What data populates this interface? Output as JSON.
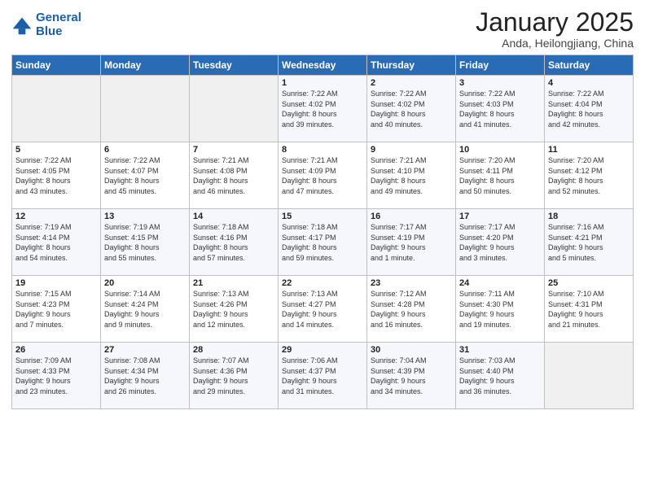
{
  "header": {
    "logo_line1": "General",
    "logo_line2": "Blue",
    "title": "January 2025",
    "subtitle": "Anda, Heilongjiang, China"
  },
  "weekdays": [
    "Sunday",
    "Monday",
    "Tuesday",
    "Wednesday",
    "Thursday",
    "Friday",
    "Saturday"
  ],
  "weeks": [
    [
      {
        "day": "",
        "info": ""
      },
      {
        "day": "",
        "info": ""
      },
      {
        "day": "",
        "info": ""
      },
      {
        "day": "1",
        "info": "Sunrise: 7:22 AM\nSunset: 4:02 PM\nDaylight: 8 hours\nand 39 minutes."
      },
      {
        "day": "2",
        "info": "Sunrise: 7:22 AM\nSunset: 4:02 PM\nDaylight: 8 hours\nand 40 minutes."
      },
      {
        "day": "3",
        "info": "Sunrise: 7:22 AM\nSunset: 4:03 PM\nDaylight: 8 hours\nand 41 minutes."
      },
      {
        "day": "4",
        "info": "Sunrise: 7:22 AM\nSunset: 4:04 PM\nDaylight: 8 hours\nand 42 minutes."
      }
    ],
    [
      {
        "day": "5",
        "info": "Sunrise: 7:22 AM\nSunset: 4:05 PM\nDaylight: 8 hours\nand 43 minutes."
      },
      {
        "day": "6",
        "info": "Sunrise: 7:22 AM\nSunset: 4:07 PM\nDaylight: 8 hours\nand 45 minutes."
      },
      {
        "day": "7",
        "info": "Sunrise: 7:21 AM\nSunset: 4:08 PM\nDaylight: 8 hours\nand 46 minutes."
      },
      {
        "day": "8",
        "info": "Sunrise: 7:21 AM\nSunset: 4:09 PM\nDaylight: 8 hours\nand 47 minutes."
      },
      {
        "day": "9",
        "info": "Sunrise: 7:21 AM\nSunset: 4:10 PM\nDaylight: 8 hours\nand 49 minutes."
      },
      {
        "day": "10",
        "info": "Sunrise: 7:20 AM\nSunset: 4:11 PM\nDaylight: 8 hours\nand 50 minutes."
      },
      {
        "day": "11",
        "info": "Sunrise: 7:20 AM\nSunset: 4:12 PM\nDaylight: 8 hours\nand 52 minutes."
      }
    ],
    [
      {
        "day": "12",
        "info": "Sunrise: 7:19 AM\nSunset: 4:14 PM\nDaylight: 8 hours\nand 54 minutes."
      },
      {
        "day": "13",
        "info": "Sunrise: 7:19 AM\nSunset: 4:15 PM\nDaylight: 8 hours\nand 55 minutes."
      },
      {
        "day": "14",
        "info": "Sunrise: 7:18 AM\nSunset: 4:16 PM\nDaylight: 8 hours\nand 57 minutes."
      },
      {
        "day": "15",
        "info": "Sunrise: 7:18 AM\nSunset: 4:17 PM\nDaylight: 8 hours\nand 59 minutes."
      },
      {
        "day": "16",
        "info": "Sunrise: 7:17 AM\nSunset: 4:19 PM\nDaylight: 9 hours\nand 1 minute."
      },
      {
        "day": "17",
        "info": "Sunrise: 7:17 AM\nSunset: 4:20 PM\nDaylight: 9 hours\nand 3 minutes."
      },
      {
        "day": "18",
        "info": "Sunrise: 7:16 AM\nSunset: 4:21 PM\nDaylight: 9 hours\nand 5 minutes."
      }
    ],
    [
      {
        "day": "19",
        "info": "Sunrise: 7:15 AM\nSunset: 4:23 PM\nDaylight: 9 hours\nand 7 minutes."
      },
      {
        "day": "20",
        "info": "Sunrise: 7:14 AM\nSunset: 4:24 PM\nDaylight: 9 hours\nand 9 minutes."
      },
      {
        "day": "21",
        "info": "Sunrise: 7:13 AM\nSunset: 4:26 PM\nDaylight: 9 hours\nand 12 minutes."
      },
      {
        "day": "22",
        "info": "Sunrise: 7:13 AM\nSunset: 4:27 PM\nDaylight: 9 hours\nand 14 minutes."
      },
      {
        "day": "23",
        "info": "Sunrise: 7:12 AM\nSunset: 4:28 PM\nDaylight: 9 hours\nand 16 minutes."
      },
      {
        "day": "24",
        "info": "Sunrise: 7:11 AM\nSunset: 4:30 PM\nDaylight: 9 hours\nand 19 minutes."
      },
      {
        "day": "25",
        "info": "Sunrise: 7:10 AM\nSunset: 4:31 PM\nDaylight: 9 hours\nand 21 minutes."
      }
    ],
    [
      {
        "day": "26",
        "info": "Sunrise: 7:09 AM\nSunset: 4:33 PM\nDaylight: 9 hours\nand 23 minutes."
      },
      {
        "day": "27",
        "info": "Sunrise: 7:08 AM\nSunset: 4:34 PM\nDaylight: 9 hours\nand 26 minutes."
      },
      {
        "day": "28",
        "info": "Sunrise: 7:07 AM\nSunset: 4:36 PM\nDaylight: 9 hours\nand 29 minutes."
      },
      {
        "day": "29",
        "info": "Sunrise: 7:06 AM\nSunset: 4:37 PM\nDaylight: 9 hours\nand 31 minutes."
      },
      {
        "day": "30",
        "info": "Sunrise: 7:04 AM\nSunset: 4:39 PM\nDaylight: 9 hours\nand 34 minutes."
      },
      {
        "day": "31",
        "info": "Sunrise: 7:03 AM\nSunset: 4:40 PM\nDaylight: 9 hours\nand 36 minutes."
      },
      {
        "day": "",
        "info": ""
      }
    ]
  ]
}
